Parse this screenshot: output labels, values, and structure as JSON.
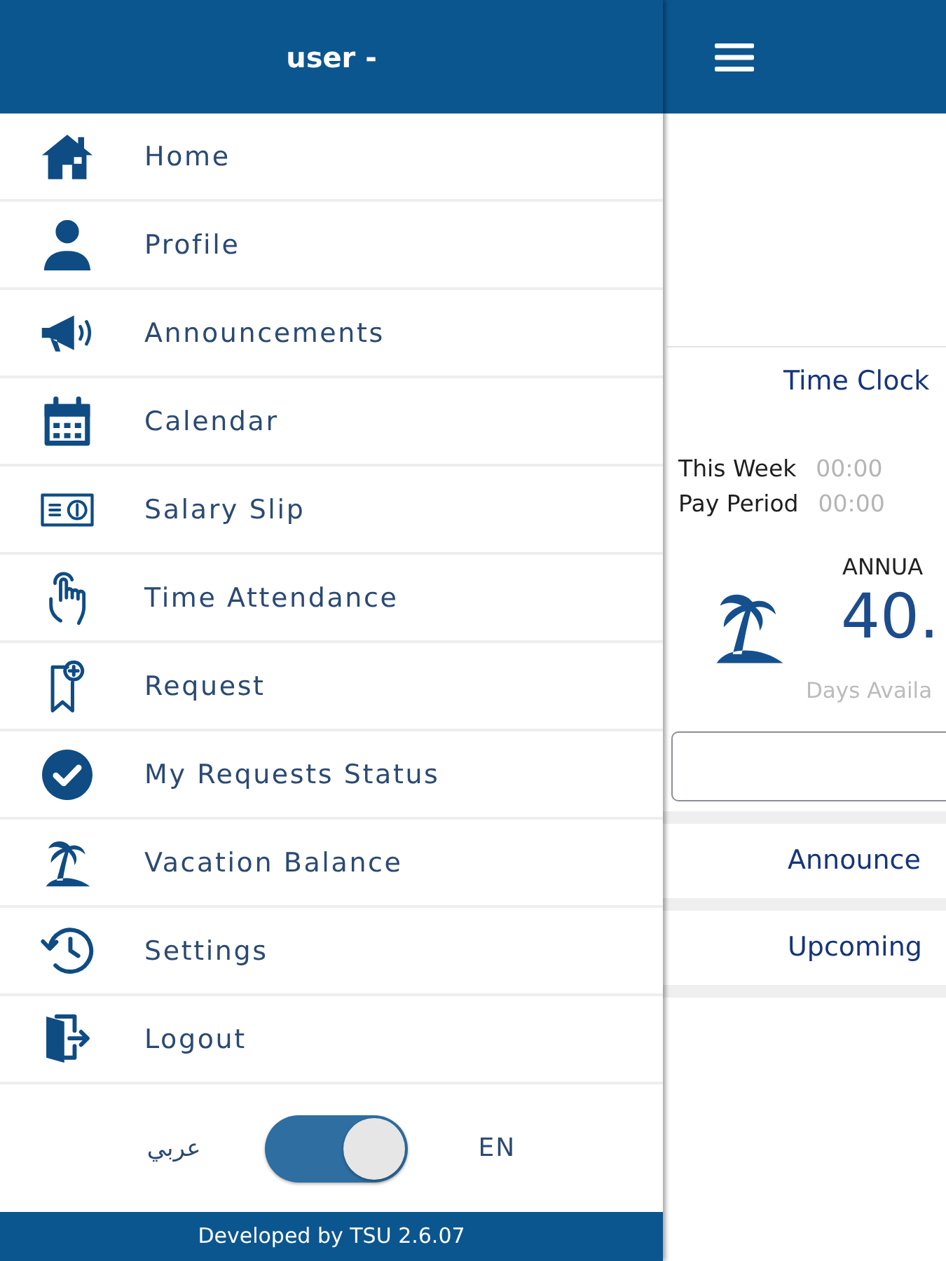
{
  "drawer": {
    "title": "user -",
    "items": [
      {
        "label": "Home"
      },
      {
        "label": "Profile"
      },
      {
        "label": "Announcements"
      },
      {
        "label": "Calendar"
      },
      {
        "label": "Salary Slip"
      },
      {
        "label": "Time Attendance"
      },
      {
        "label": "Request"
      },
      {
        "label": "My Requests Status"
      },
      {
        "label": "Vacation Balance"
      },
      {
        "label": "Settings"
      },
      {
        "label": "Logout"
      }
    ],
    "language": {
      "left_label": "عربي",
      "right_label": "EN",
      "on": true
    },
    "footer": "Developed by TSU 2.6.07"
  },
  "main": {
    "time_clock": {
      "title": "Time Clock",
      "rows": [
        {
          "label": "This Week",
          "value": "00:00"
        },
        {
          "label": "Pay Period",
          "value": "00:00"
        }
      ]
    },
    "vacation": {
      "type": "ANNUA",
      "balance": "40.",
      "caption": "Days Availa"
    },
    "sections": [
      {
        "title": "Announce"
      },
      {
        "title": "Upcoming"
      }
    ]
  }
}
